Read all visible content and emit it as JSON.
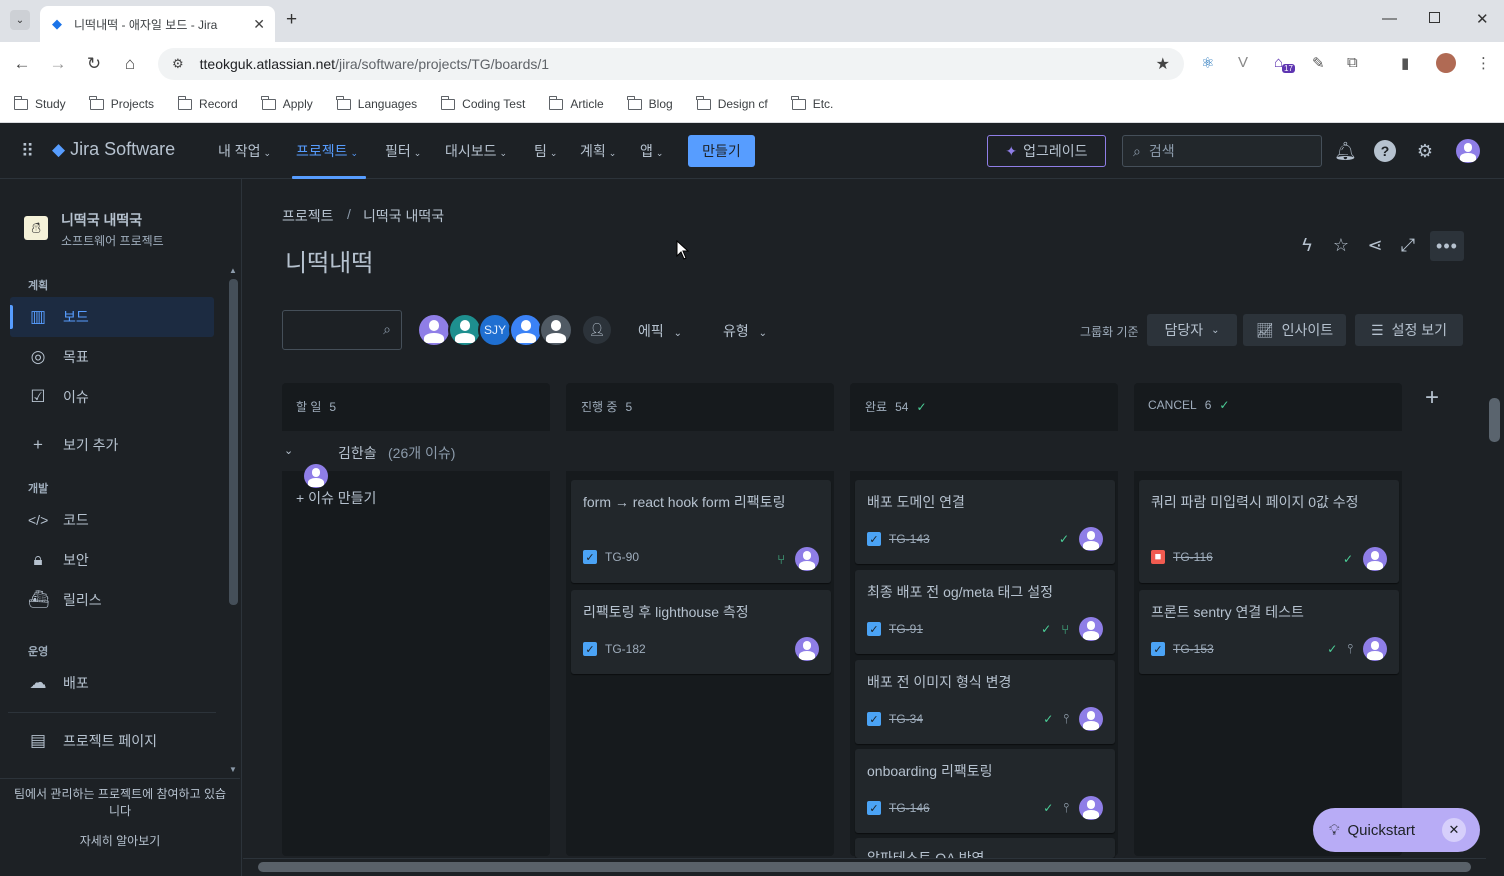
{
  "browser": {
    "tab_title": "니떡내떡 - 애자일 보드 - Jira",
    "url_host": "tteokguk.atlassian.net",
    "url_path": "/jira/software/projects/TG/boards/1",
    "ext_badge": "17",
    "bookmarks": [
      "Study",
      "Projects",
      "Record",
      "Apply",
      "Languages",
      "Coding Test",
      "Article",
      "Blog",
      "Design cf",
      "Etc."
    ]
  },
  "topnav": {
    "product": "Jira Software",
    "items": [
      {
        "label": "내 작업"
      },
      {
        "label": "프로젝트"
      },
      {
        "label": "필터"
      },
      {
        "label": "대시보드"
      },
      {
        "label": "팀"
      },
      {
        "label": "계획"
      },
      {
        "label": "앱"
      }
    ],
    "create": "만들기",
    "upgrade": "업그레이드",
    "search_placeholder": "검색"
  },
  "sidebar": {
    "project_name": "니떡국 내떡국",
    "project_type": "소프트웨어 프로젝트",
    "section_plan": "계획",
    "board": "보드",
    "goals": "목표",
    "issues": "이슈",
    "add_view": "보기 추가",
    "section_dev": "개발",
    "code": "코드",
    "security": "보안",
    "release": "릴리스",
    "section_ops": "운영",
    "deploy": "배포",
    "project_pages": "프로젝트 페이지",
    "footer_text": "팀에서 관리하는 프로젝트에 참여하고 있습니다",
    "learn_more": "자세히 알아보기"
  },
  "main": {
    "breadcrumb_root": "프로젝트",
    "breadcrumb_sep": "/",
    "breadcrumb_project": "니떡국 내떡국",
    "title": "니떡내떡",
    "avatar_initials": "SJY",
    "filter_epic": "에픽",
    "filter_type": "유형",
    "group_by_label": "그룹화 기준",
    "group_by_value": "담당자",
    "insights": "인사이트",
    "view_settings": "설정 보기"
  },
  "board": {
    "columns": [
      {
        "name": "할 일",
        "count": "5"
      },
      {
        "name": "진행 중",
        "count": "5"
      },
      {
        "name": "완료",
        "count": "54"
      },
      {
        "name": "CANCEL",
        "count": "6"
      }
    ],
    "swimlane_name": "김한솔",
    "swimlane_count": "(26개 이슈)",
    "create_issue": "+ 이슈 만들기",
    "cards_in_progress": [
      {
        "title": "form → react hook form 리팩토링",
        "key": "TG-90"
      },
      {
        "title": "리팩토링 후 lighthouse 측정",
        "key": "TG-182"
      }
    ],
    "cards_done": [
      {
        "title": "배포 도메인 연결",
        "key": "TG-143"
      },
      {
        "title": "최종 배포 전 og/meta 태그 설정",
        "key": "TG-91"
      },
      {
        "title": "배포 전 이미지 형식 변경",
        "key": "TG-34"
      },
      {
        "title": "onboarding 리팩토링",
        "key": "TG-146"
      },
      {
        "title": "알파테스트 QA 반영",
        "key": ""
      }
    ],
    "cards_cancel": [
      {
        "title": "쿼리 파람 미입력시 페이지 0값 수정",
        "key": "TG-116"
      },
      {
        "title": "프론트 sentry 연결 테스트",
        "key": "TG-153"
      }
    ]
  },
  "quickstart": "Quickstart",
  "colors": {
    "accent": "#579dff",
    "bg": "#1d2125",
    "column": "#161a1d",
    "card": "#22272b",
    "done": "#4bce97",
    "avatar": "#8f7ee7"
  }
}
